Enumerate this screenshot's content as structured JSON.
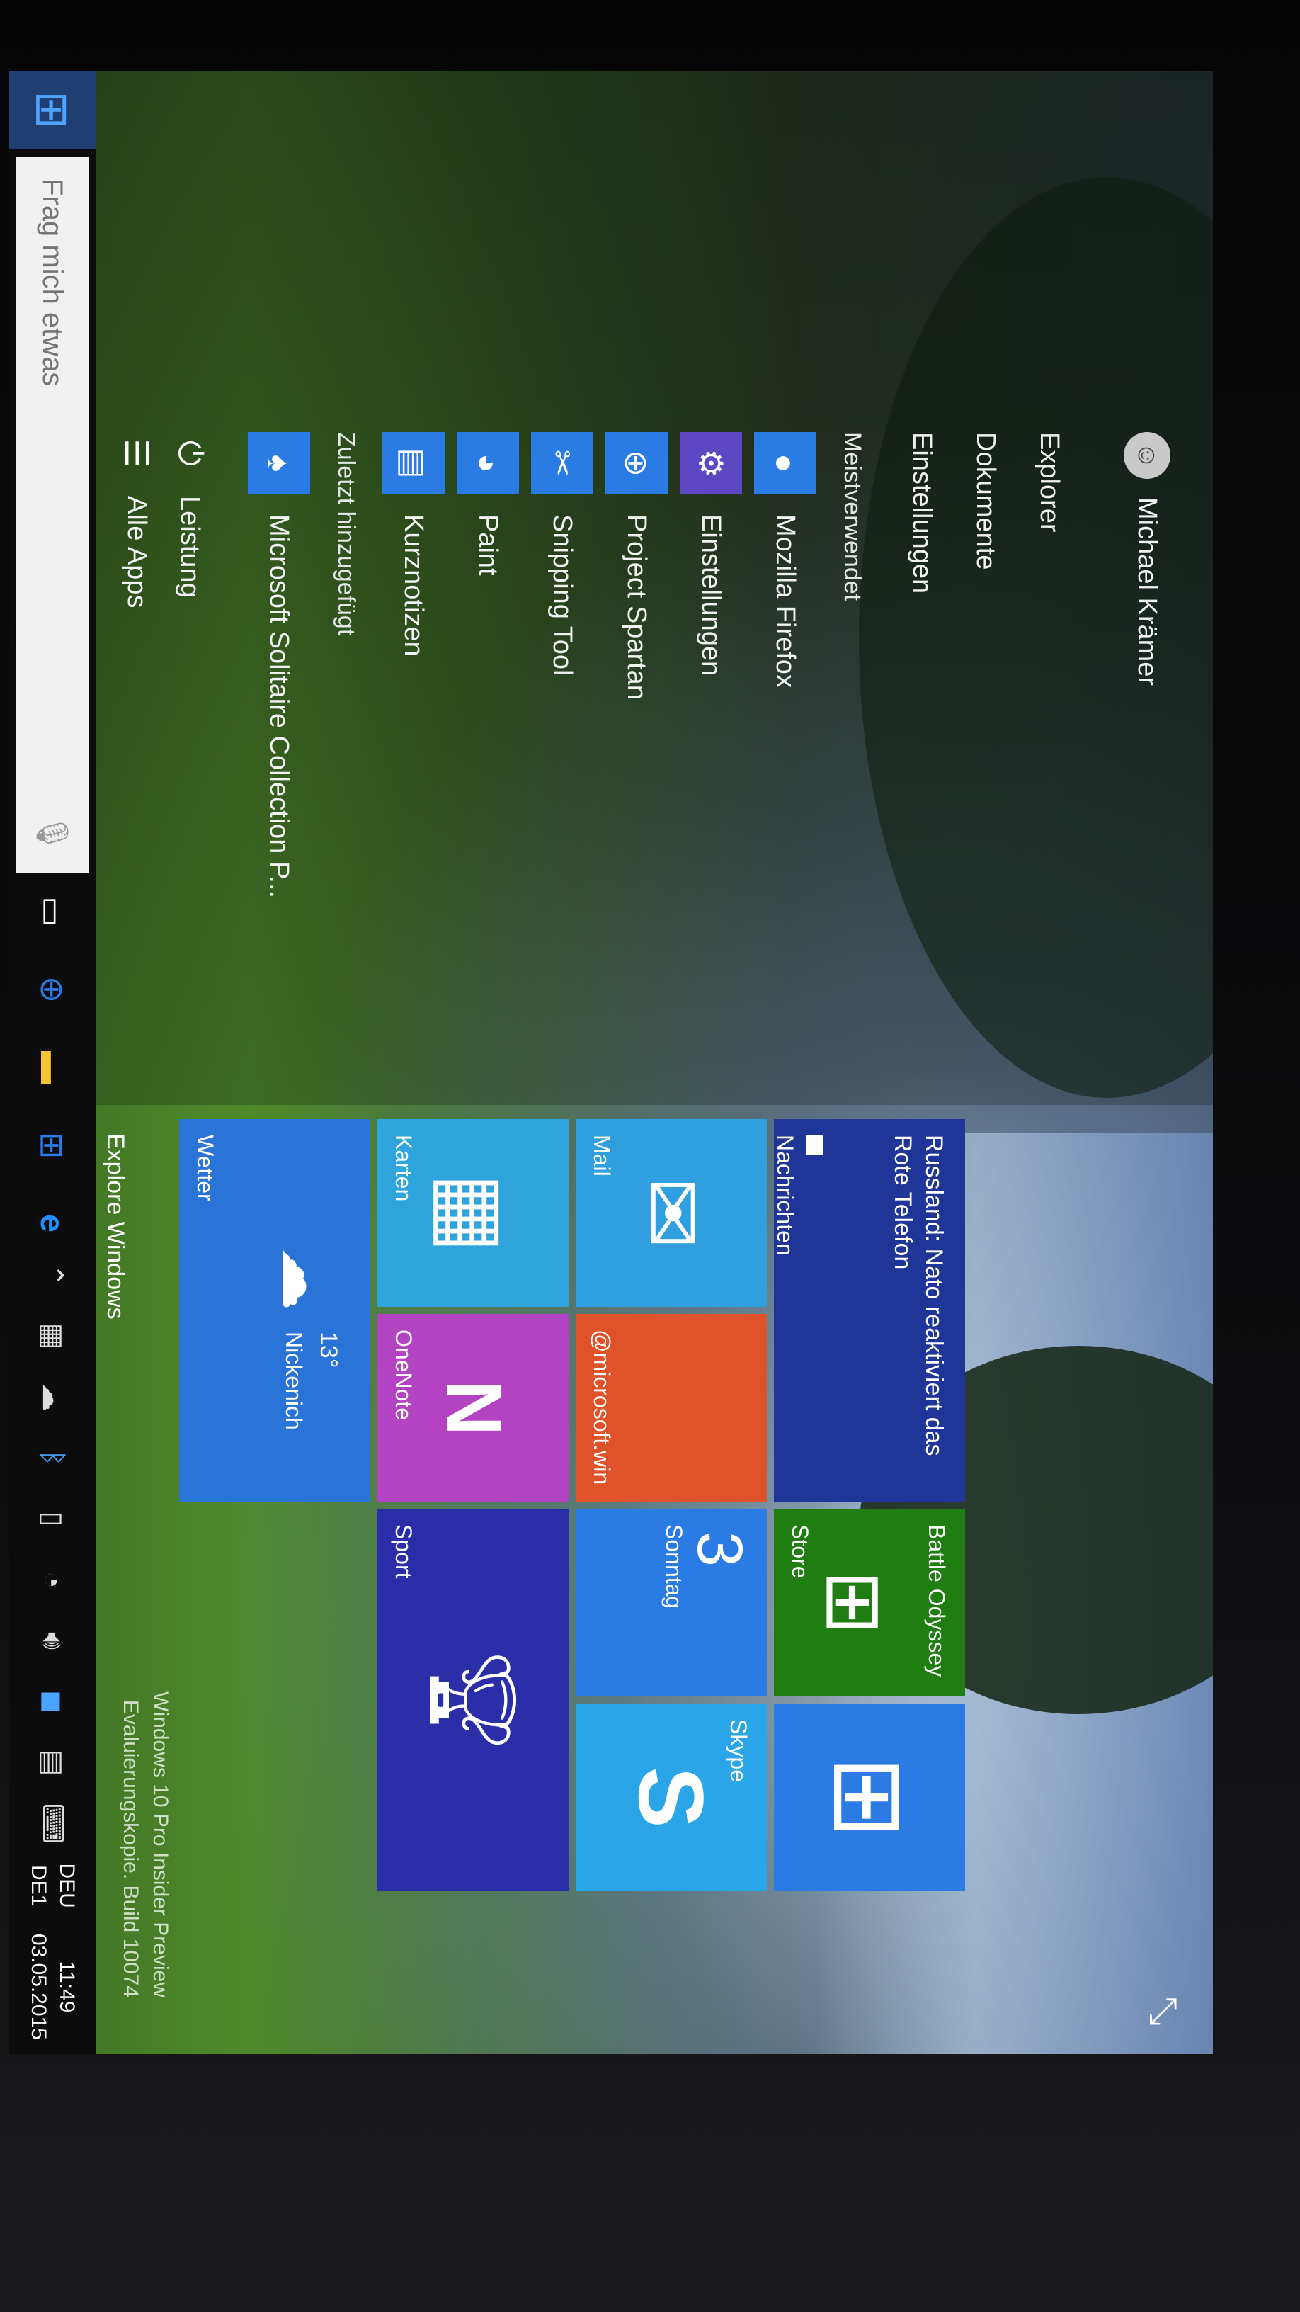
{
  "start_menu": {
    "user_name": "Michael Krämer",
    "links": [
      "Explorer",
      "Dokumente",
      "Einstellungen"
    ],
    "most_used_heading": "Meistverwendet",
    "most_used": [
      {
        "label": "Mozilla Firefox",
        "icon": "firefox-icon",
        "color": "#2a7be4",
        "glyph": "●"
      },
      {
        "label": "Einstellungen",
        "icon": "gear-icon",
        "color": "#5d47c2",
        "glyph": "⚙"
      },
      {
        "label": "Project Spartan",
        "icon": "globe-icon",
        "color": "#2a7be4",
        "glyph": "⊕"
      },
      {
        "label": "Snipping Tool",
        "icon": "scissors-icon",
        "color": "#2a7be4",
        "glyph": "✂"
      },
      {
        "label": "Paint",
        "icon": "palette-icon",
        "color": "#2a7be4",
        "glyph": "◕"
      },
      {
        "label": "Kurznotizen",
        "icon": "sticky-note-icon",
        "color": "#2a7be4",
        "glyph": "▤"
      }
    ],
    "recent_heading": "Zuletzt hinzugefügt",
    "recent": [
      {
        "label": "Microsoft Solitaire Collection P...",
        "icon": "cards-icon",
        "color": "#2a7be4",
        "glyph": "♠"
      }
    ],
    "power_label": "Leistung",
    "all_apps_label": "Alle Apps"
  },
  "tiles": {
    "news_headline": "Russland: Nato reaktiviert das Rote Telefon",
    "news_label": "Nachrichten",
    "game_title": "Battle Odyssey",
    "store_label": "Store",
    "mail_label": "Mail",
    "twitter_handle": "@microsoft.win",
    "calendar_number": "3",
    "calendar_day": "Sonntag",
    "skype_label": "Skype",
    "maps_label": "Karten",
    "onenote_label": "OneNote",
    "sport_label": "Sport",
    "weather_temp": "13°",
    "weather_city": "Nickenich",
    "weather_label": "Wetter"
  },
  "taskbar": {
    "search_placeholder": "Frag mich etwas",
    "explore_text": "Explore Windows",
    "lang_top": "DEU",
    "lang_bottom": "DE1",
    "time": "11:49",
    "date": "03.05.2015"
  },
  "watermark": {
    "line1": "Windows 10 Pro Insider Preview",
    "line2": "Evaluierungskopie. Build 10074"
  },
  "colors": {
    "news_tile": "#1f3598",
    "store_green": "#1f7d12",
    "store_blue": "#2a7be4",
    "mail_tile": "#2f9fe0",
    "twitter_tile": "#e0522a",
    "calendar_tile": "#2a7be4",
    "skype_tile": "#2aa6e8",
    "maps_tile": "#2fa4dc",
    "onenote_tile": "#b443c4",
    "sport_tile": "#2a2ea8",
    "weather_tile": "#2a74d8"
  }
}
